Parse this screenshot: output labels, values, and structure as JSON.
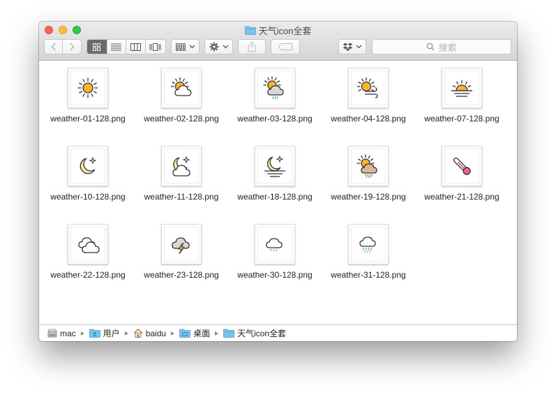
{
  "window": {
    "title": "天气icon全套"
  },
  "toolbar": {
    "search_placeholder": "搜索",
    "view_modes": [
      "icon",
      "list",
      "column",
      "coverflow"
    ],
    "active_view": "icon"
  },
  "files": [
    {
      "name": "weather-01-128.png",
      "icon": "sun"
    },
    {
      "name": "weather-02-128.png",
      "icon": "sun-cloud"
    },
    {
      "name": "weather-03-128.png",
      "icon": "sun-cloud-rain"
    },
    {
      "name": "weather-04-128.png",
      "icon": "sun-wind"
    },
    {
      "name": "weather-07-128.png",
      "icon": "sunrise"
    },
    {
      "name": "weather-10-128.png",
      "icon": "moon-star"
    },
    {
      "name": "weather-11-128.png",
      "icon": "moon-cloud"
    },
    {
      "name": "weather-18-128.png",
      "icon": "moon-horizon"
    },
    {
      "name": "weather-19-128.png",
      "icon": "sun-cloud-snow"
    },
    {
      "name": "weather-21-128.png",
      "icon": "thermometer"
    },
    {
      "name": "weather-22-128.png",
      "icon": "clouds"
    },
    {
      "name": "weather-23-128.png",
      "icon": "thunderstorm"
    },
    {
      "name": "weather-30-128.png",
      "icon": "cloud-light-rain"
    },
    {
      "name": "weather-31-128.png",
      "icon": "cloud-rain"
    }
  ],
  "path": [
    {
      "label": "mac",
      "icon": "hard-drive"
    },
    {
      "label": "用户",
      "icon": "users-folder"
    },
    {
      "label": "baidu",
      "icon": "home"
    },
    {
      "label": "桌面",
      "icon": "desktop-folder"
    },
    {
      "label": "天气icon全套",
      "icon": "folder"
    }
  ],
  "colors": {
    "sun": "#f6b52b",
    "stroke": "#333333",
    "rain": "#49a7d9",
    "moon": "#f8e7a0",
    "thermometer": "#e5657a",
    "folder": "#79c3ef"
  }
}
